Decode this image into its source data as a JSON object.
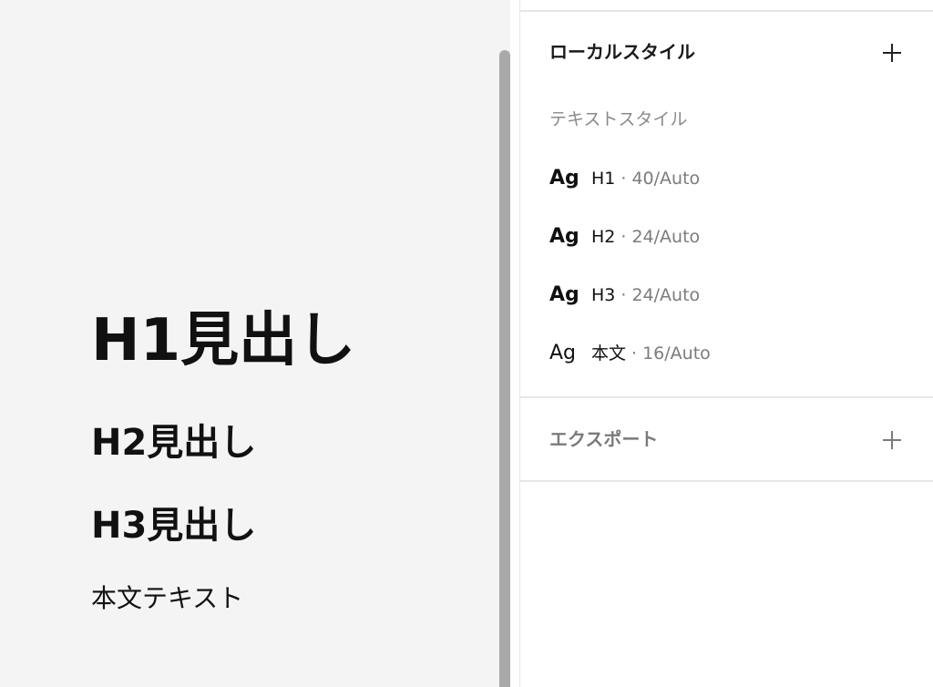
{
  "canvas": {
    "h1_text": "H1見出し",
    "h2_text": "H2見出し",
    "h3_text": "H3見出し",
    "body_text": "本文テキスト"
  },
  "panel": {
    "local_styles": {
      "title": "ローカルスタイル",
      "add_icon": "plus-icon"
    },
    "text_styles": {
      "subtitle": "テキストスタイル",
      "items": [
        {
          "preview": "Ag",
          "name": "H1",
          "meta": "· 40/Auto",
          "weight": "bold"
        },
        {
          "preview": "Ag",
          "name": "H2",
          "meta": "· 24/Auto",
          "weight": "bold"
        },
        {
          "preview": "Ag",
          "name": "H3",
          "meta": "· 24/Auto",
          "weight": "bold"
        },
        {
          "preview": "Ag",
          "name": "本文",
          "meta": "· 16/Auto",
          "weight": "regular"
        }
      ]
    },
    "export": {
      "title": "エクスポート",
      "add_icon": "plus-icon"
    }
  },
  "colors": {
    "canvas_bg": "#f4f4f4",
    "panel_bg": "#ffffff",
    "divider": "#e6e6e6",
    "muted_text": "#7b7b7b",
    "scrollbar": "#a9a9a9"
  }
}
